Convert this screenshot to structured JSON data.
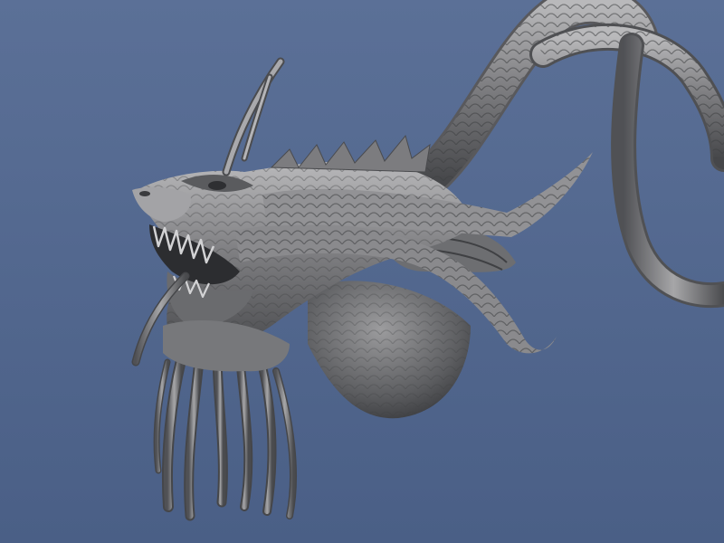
{
  "scene": {
    "subject": "dragon-head-sculpt",
    "background_top": "#5b7097",
    "background_bottom": "#4a5f86",
    "material": "#8a8a8c",
    "material_shadow": "#3e3f42",
    "material_highlight": "#c9c9cb"
  }
}
